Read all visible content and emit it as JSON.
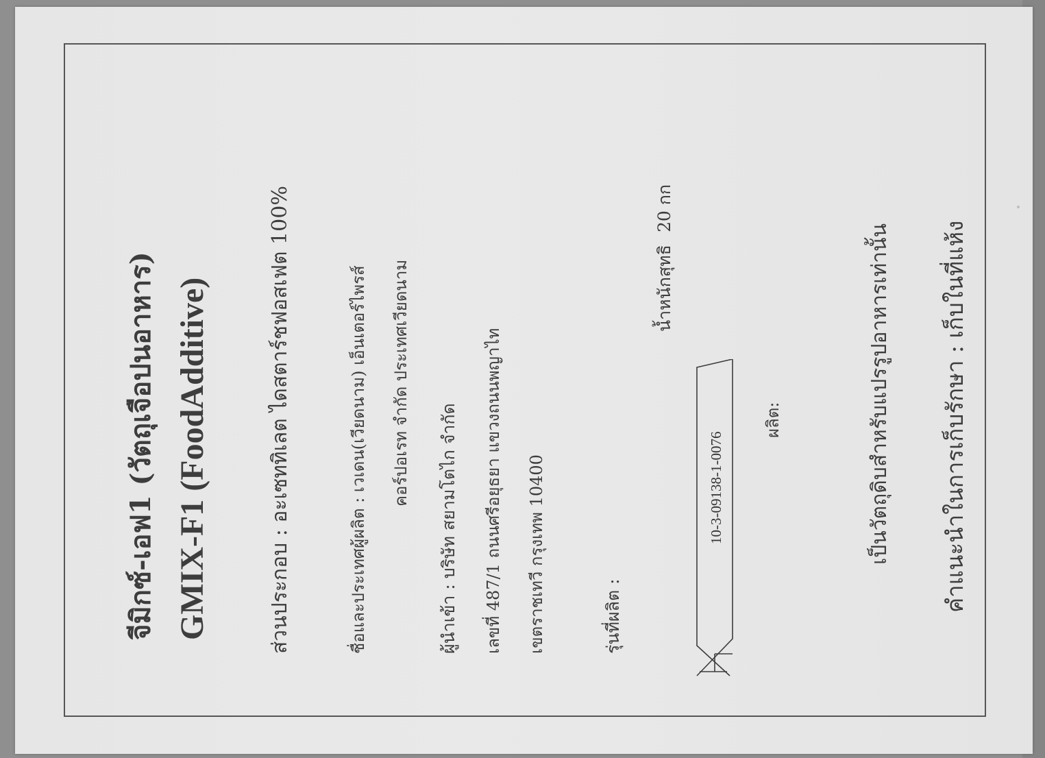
{
  "label": {
    "title_thai": "จีมิกซ์-เอฟ1 (วัตถุเจือปนอาหาร)",
    "title_en": "GMIX-F1 (FoodAdditive)",
    "composition": "ส่วนประกอบ :  อะเซททิเลต ไดสตาร์ชฟอสเฟต 100%",
    "manufacturer_line1": "ชื่อและประเทศผู้ผลิต : เวเดน(เวียดนาม) เอ็นเตอร์ไพรส์",
    "manufacturer_line2": "คอร์ปอเรท จำกัด ประเทศเวียดนาม",
    "importer": "ผู้นำเข้า : บริษัท สยามโตไก จำกัด",
    "address_line1": "เลขที่ 487/1 ถนนศรีอยุธยา แขวงถนนพญาไท",
    "address_line2": "เขตราชเทวี กรุงเทพ 10400",
    "lot_label": "รุ่นที่ผลิต :",
    "net_weight_label": "น้ำหนักสุทธิ",
    "net_weight_value": "20 กก",
    "fda_number": "10-3-09138-1-0076",
    "mfg_label": "ผลิต:",
    "usage_note": "เป็นวัตถุดิบสำหรับแปรรูปอาหารเท่านั้น",
    "storage_note": "คำแนะนำในการเก็บรักษา : เก็บในที่แห้ง"
  },
  "colors": {
    "paper": "#e7e7e7",
    "ink": "#3d3d3d",
    "background": "#8f8f8f"
  }
}
